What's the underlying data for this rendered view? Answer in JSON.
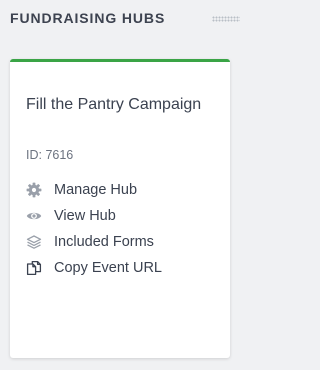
{
  "section": {
    "title": "FUNDRAISING HUBS"
  },
  "hub_card": {
    "accent_color": "#3aa446",
    "title": "Fill the Pantry Campaign",
    "id_text": "ID: 7616",
    "actions": [
      {
        "label": "Manage Hub",
        "icon": "gear-icon"
      },
      {
        "label": "View Hub",
        "icon": "eye-icon"
      },
      {
        "label": "Included Forms",
        "icon": "layers-icon"
      },
      {
        "label": "Copy Event URL",
        "icon": "copy-icon"
      }
    ]
  }
}
